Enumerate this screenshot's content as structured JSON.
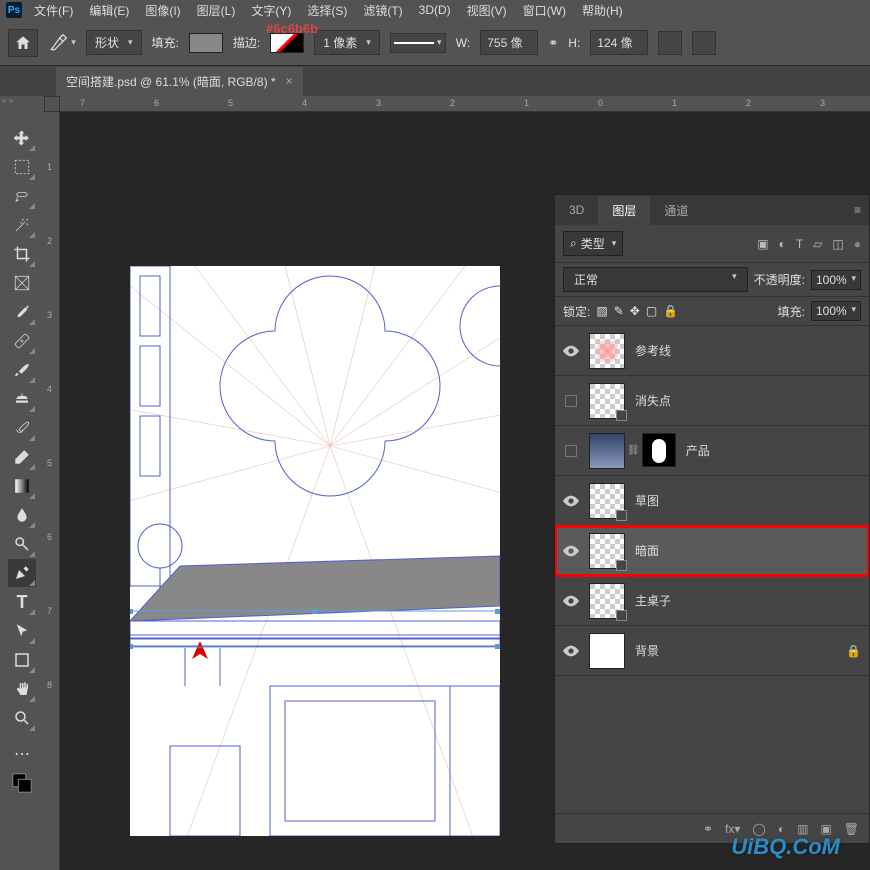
{
  "annotation": "#6c6b6b",
  "menubar": [
    "文件(F)",
    "编辑(E)",
    "图像(I)",
    "图层(L)",
    "文字(Y)",
    "选择(S)",
    "滤镜(T)",
    "3D(D)",
    "视图(V)",
    "窗口(W)",
    "帮助(H)"
  ],
  "options": {
    "mode": "形状",
    "fill_label": "填充:",
    "stroke_label": "描边:",
    "stroke_width": "1 像素",
    "w_label": "W:",
    "w_value": "755 像",
    "h_label": "H:",
    "h_value": "124 像",
    "link_icon": "⚭"
  },
  "document": {
    "title": "空间搭建.psd @ 61.1% (暗面, RGB/8) *"
  },
  "ruler_h": {
    "7": 20,
    "6": 94,
    "5": 168,
    "4": 242,
    "3": 316,
    "2": 390,
    "1": 464,
    "0": 538,
    "1b": 612,
    "2b": 686,
    "3b": 760
  },
  "ruler_v": [
    "1",
    "2",
    "3",
    "4",
    "5",
    "6",
    "7",
    "8"
  ],
  "panel": {
    "tabs": {
      "t3d": "3D",
      "layers": "图层",
      "channels": "通道"
    },
    "filter": {
      "search_icon": "⌕",
      "label": "类型"
    },
    "blend": {
      "mode": "正常",
      "opacity_label": "不透明度:",
      "opacity": "100%",
      "fill_label": "填充:",
      "fill": "100%",
      "lock_label": "锁定:"
    },
    "layers": [
      {
        "name": "参考线",
        "visible": true,
        "thumb": "checker-pink",
        "badge": false
      },
      {
        "name": "消失点",
        "visible": false,
        "thumb": "checker",
        "badge": true
      },
      {
        "name": "产品",
        "visible": false,
        "thumb": "product-mask",
        "badge": false
      },
      {
        "name": "草图",
        "visible": true,
        "thumb": "checker-sketch",
        "badge": true
      },
      {
        "name": "暗面",
        "visible": true,
        "thumb": "checker-dark",
        "badge": true,
        "selected": true
      },
      {
        "name": "主桌子",
        "visible": true,
        "thumb": "checker-table",
        "badge": true
      },
      {
        "name": "背景",
        "visible": true,
        "thumb": "white",
        "locked": true
      }
    ]
  },
  "watermark": "UiBQ.CoM"
}
